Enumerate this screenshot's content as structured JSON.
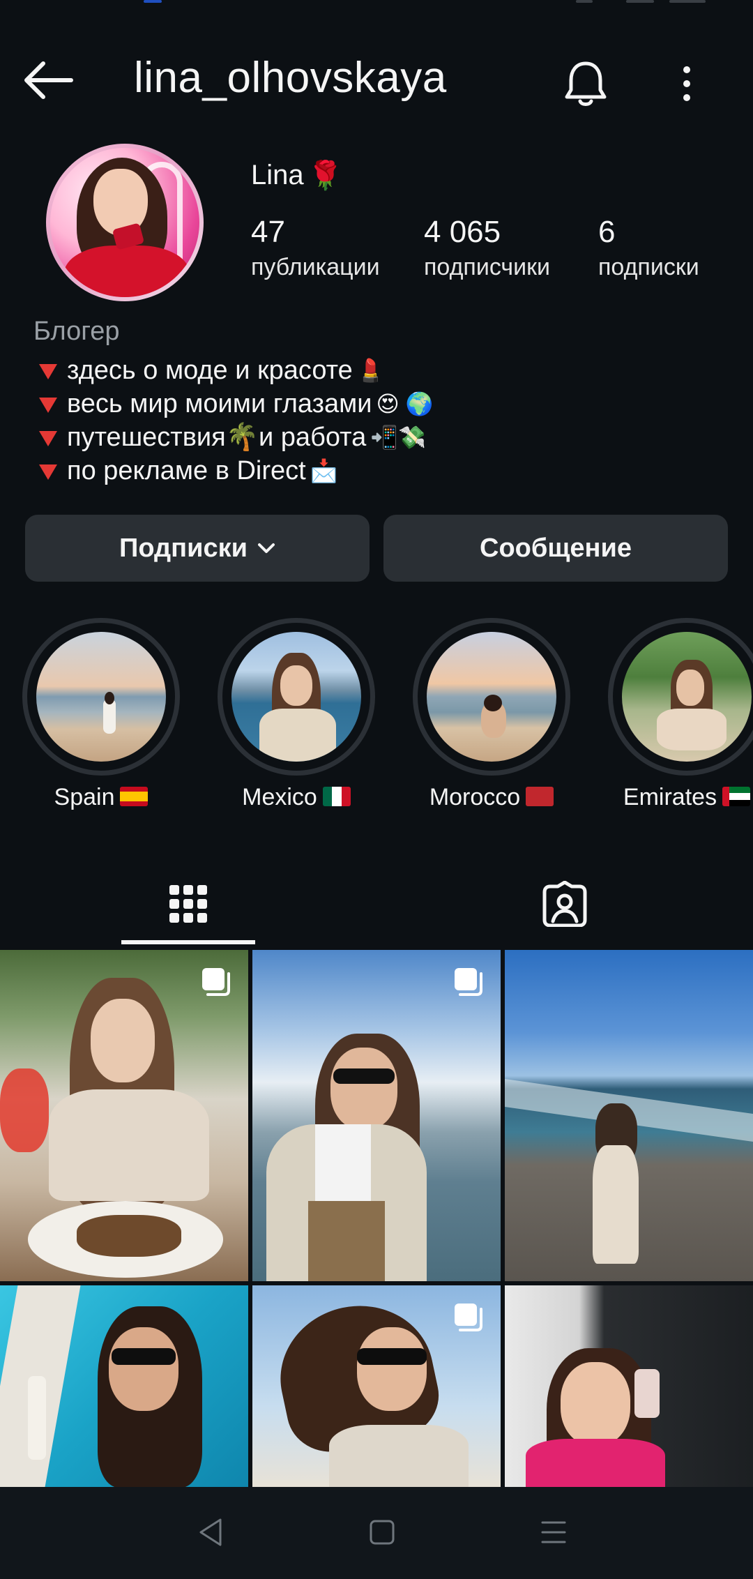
{
  "header": {
    "username": "lina_olhovskaya"
  },
  "profile": {
    "display_name": "Lina",
    "name_emoji": "🌹",
    "stats": [
      {
        "value": "47",
        "label": "публикации"
      },
      {
        "value": "4 065",
        "label": "подписчики"
      },
      {
        "value": "6",
        "label": "подписки"
      }
    ]
  },
  "bio": {
    "category": "Блогер",
    "lines": [
      {
        "text": "здесь о моде и красоте",
        "emoji": "💄"
      },
      {
        "text": "весь мир моими глазами",
        "emoji": "😍 🌍"
      },
      {
        "text": "путешествия🌴и работа",
        "emoji": "📲💸"
      },
      {
        "text": "по рекламе в Direct",
        "emoji": "📩"
      }
    ]
  },
  "actions": {
    "following_label": "Подписки",
    "message_label": "Сообщение"
  },
  "highlights": [
    {
      "label": "Spain"
    },
    {
      "label": "Mexico"
    },
    {
      "label": "Morocco"
    },
    {
      "label": "Emirates"
    }
  ],
  "colors": {
    "background": "#0c1014",
    "button_bg": "#2a2f34",
    "text": "#f5f5f5",
    "secondary_text": "#9aa0a6",
    "bullet_red": "#e53935"
  }
}
